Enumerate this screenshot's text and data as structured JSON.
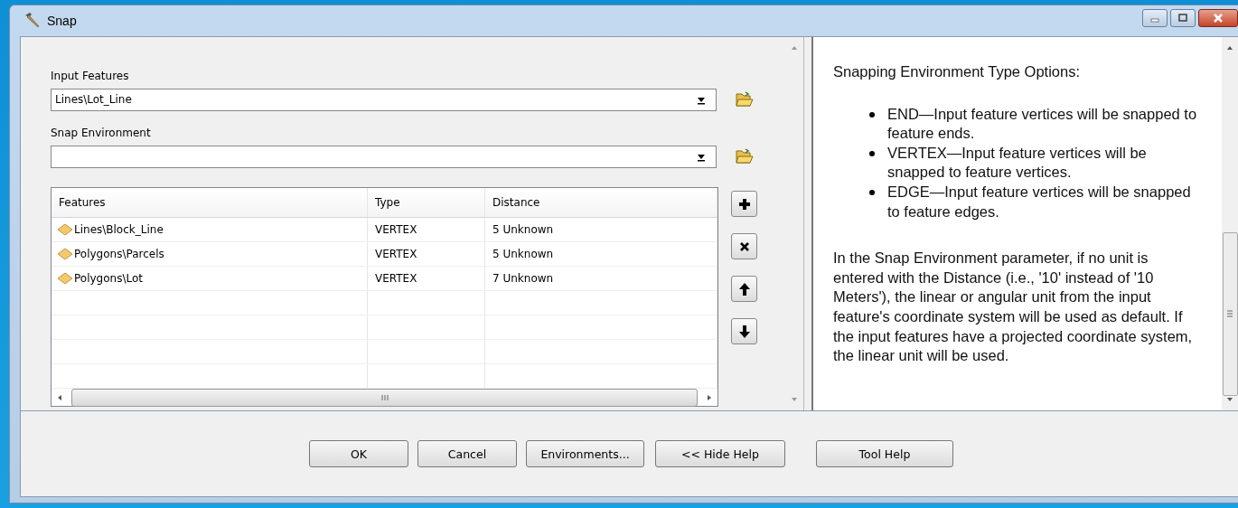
{
  "window": {
    "title": "Snap"
  },
  "input_features": {
    "label": "Input Features",
    "value": "Lines\\Lot_Line"
  },
  "snap_environment": {
    "label": "Snap Environment"
  },
  "table": {
    "columns": [
      "Features",
      "Type",
      "Distance"
    ],
    "rows": [
      {
        "features": "Lines\\Block_Line",
        "type": "VERTEX",
        "distance": "5 Unknown"
      },
      {
        "features": "Polygons\\Parcels",
        "type": "VERTEX",
        "distance": "5 Unknown"
      },
      {
        "features": "Polygons\\Lot",
        "type": "VERTEX",
        "distance": "7 Unknown"
      }
    ]
  },
  "help": {
    "heading": "Snapping Environment Type Options:",
    "bullets": [
      "END—Input feature vertices will be snapped to feature ends.",
      "VERTEX—Input feature vertices will be snapped to feature vertices.",
      "EDGE—Input feature vertices will be snapped to feature edges."
    ],
    "paragraph": "In the Snap Environment parameter, if no unit is entered with the Distance (i.e., '10' instead of '10 Meters'), the linear or angular unit from the input feature's coordinate system will be used as default. If the input features have a projected coordinate system, the linear unit will be used."
  },
  "buttons": [
    "OK",
    "Cancel",
    "Environments...",
    "<< Hide Help",
    "Tool Help"
  ]
}
